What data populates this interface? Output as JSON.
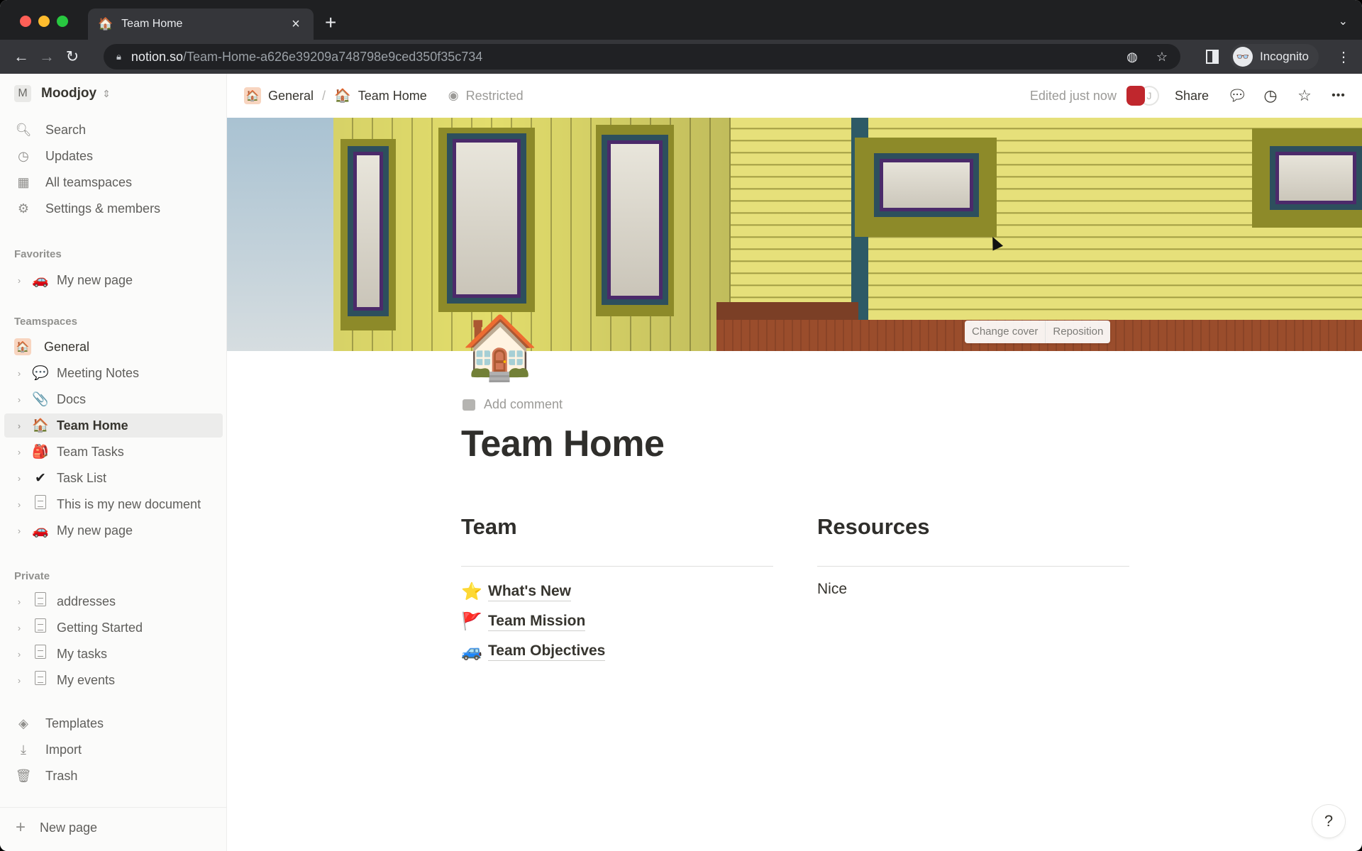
{
  "browser": {
    "tab": {
      "favicon": "🏠",
      "title": "Team Home",
      "close": "×"
    },
    "new_tab": "+",
    "tab_list": "⌄",
    "nav": {
      "back": "←",
      "forward": "→",
      "reload": "↻"
    },
    "url": {
      "host": "notion.so",
      "path": "/Team-Home-a626e39209a748798e9ced350f35c734"
    },
    "omnibox_icons": {
      "tracking": "◍",
      "bookmark": "☆"
    },
    "profile": {
      "icon": "👓",
      "label": "Incognito"
    },
    "menu": "⋮"
  },
  "sidebar": {
    "workspace": {
      "initial": "M",
      "name": "Moodjoy",
      "switcher": "⇕"
    },
    "top_items": [
      {
        "icon": "🔍︎",
        "label": "Search"
      },
      {
        "icon": "◷",
        "label": "Updates"
      },
      {
        "icon": "▦",
        "label": "All teamspaces"
      },
      {
        "icon": "⚙",
        "label": "Settings & members"
      }
    ],
    "favorites": {
      "heading": "Favorites",
      "items": [
        {
          "emoji": "🚗",
          "label": "My new page"
        }
      ]
    },
    "teamspaces": {
      "heading": "Teamspaces",
      "general": {
        "icon": "🏠",
        "label": "General"
      },
      "items": [
        {
          "emoji": "💬",
          "label": "Meeting Notes"
        },
        {
          "emoji": "📎",
          "label": "Docs"
        },
        {
          "emoji": "🏠",
          "label": "Team Home",
          "active": true
        },
        {
          "emoji": "🎒",
          "label": "Team Tasks"
        },
        {
          "emoji": "✔",
          "label": "Task List"
        },
        {
          "emoji": "doc",
          "label": "This is my new document"
        },
        {
          "emoji": "🚗",
          "label": "My new page"
        }
      ]
    },
    "private": {
      "heading": "Private",
      "items": [
        {
          "label": "addresses"
        },
        {
          "label": "Getting Started"
        },
        {
          "label": "My tasks"
        },
        {
          "label": "My events"
        }
      ]
    },
    "utilities": [
      {
        "icon": "◈",
        "label": "Templates"
      },
      {
        "icon": "⤓",
        "label": "Import"
      },
      {
        "icon": "🗑︎",
        "label": "Trash"
      }
    ],
    "new_page": {
      "icon": "+",
      "label": "New page"
    }
  },
  "topbar": {
    "breadcrumb": [
      {
        "icon": "🏠",
        "label": "General"
      },
      {
        "icon": "🏠",
        "label": "Team Home"
      }
    ],
    "separator": "/",
    "restricted": {
      "icon": "◉",
      "label": "Restricted"
    },
    "edited": "Edited just now",
    "avatar_initial": "J",
    "share": "Share",
    "icons": {
      "comments": "💬︎",
      "history": "◷",
      "favorite": "☆",
      "more": "•••"
    }
  },
  "cover": {
    "change_cover": "Change cover",
    "reposition": "Reposition"
  },
  "page": {
    "icon": "🏠",
    "add_comment": "Add comment",
    "title": "Team Home",
    "columns": {
      "team": {
        "heading": "Team",
        "links": [
          {
            "emoji": "⭐",
            "label": "What's New"
          },
          {
            "emoji": "🚩",
            "label": "Team Mission"
          },
          {
            "emoji": "🚙",
            "label": "Team Objectives"
          }
        ]
      },
      "resources": {
        "heading": "Resources",
        "text": "Nice"
      }
    }
  },
  "help": "?"
}
